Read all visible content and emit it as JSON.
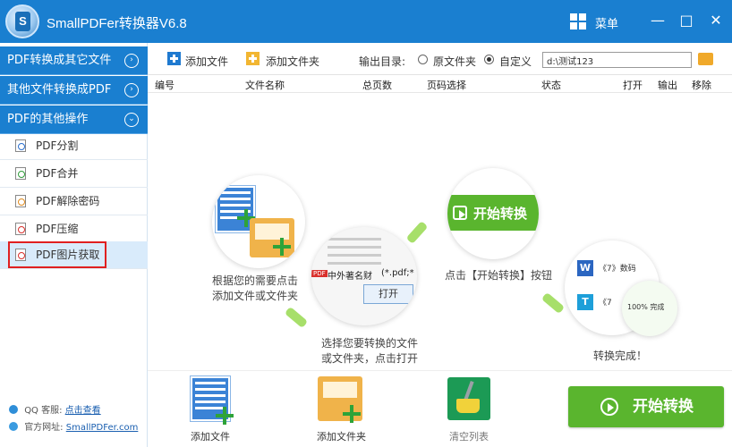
{
  "app": {
    "title": "SmallPDFer转换器V6.8",
    "logo_letter": "S",
    "menu_label": "菜单"
  },
  "window": {
    "minimize": "—",
    "maximize": "□",
    "close": "✕"
  },
  "sidebar": {
    "categories": [
      {
        "label": "PDF转换成其它文件",
        "chevron": "›"
      },
      {
        "label": "其他文件转换成PDF",
        "chevron": "›"
      },
      {
        "label": "PDF的其他操作",
        "chevron": "⌄"
      }
    ],
    "items": [
      {
        "label": "PDF分割",
        "icon": "pdf-split-icon"
      },
      {
        "label": "PDF合并",
        "icon": "pdf-merge-icon"
      },
      {
        "label": "PDF解除密码",
        "icon": "pdf-unlock-icon"
      },
      {
        "label": "PDF压缩",
        "icon": "pdf-compress-icon"
      },
      {
        "label": "PDF图片获取",
        "icon": "pdf-image-icon"
      }
    ],
    "footer": {
      "qq_label": "QQ 客服:",
      "qq_link": "点击查看",
      "site_label": "官方网址:",
      "site_link": "SmallPDFer.com"
    }
  },
  "toolbar": {
    "add_file": "添加文件",
    "add_folder": "添加文件夹",
    "output_label": "输出目录:",
    "radio_source": "原文件夹",
    "radio_custom": "自定义",
    "output_path": "d:\\测试123"
  },
  "table": {
    "columns": [
      "编号",
      "文件名称",
      "总页数",
      "页码选择",
      "状态",
      "打开",
      "输出",
      "移除"
    ]
  },
  "guide": {
    "step1": "根据您的需要点击\n添加文件或文件夹",
    "step2": "选择您要转换的文件\n或文件夹，点击打开",
    "step2_file": "中外著名财",
    "step2_ext": "(*.pdf;*",
    "step2_open": "打开",
    "step3": "点击【开始转换】按钮",
    "step3_button": "开始转换",
    "step4": "转换完成！",
    "step4_item1": "《7》数码",
    "step4_item2": "《7",
    "step4_progress": "100%  完成",
    "word_letter": "W",
    "txt_letter": "T",
    "pdf_tag": "PDF"
  },
  "bottom": {
    "add_file": "添加文件",
    "add_folder": "添加文件夹",
    "clear_list": "清空列表",
    "start": "开始转换"
  },
  "colors": {
    "primary": "#1a7fd0",
    "green": "#5ab52e",
    "highlight": "#e02020"
  }
}
